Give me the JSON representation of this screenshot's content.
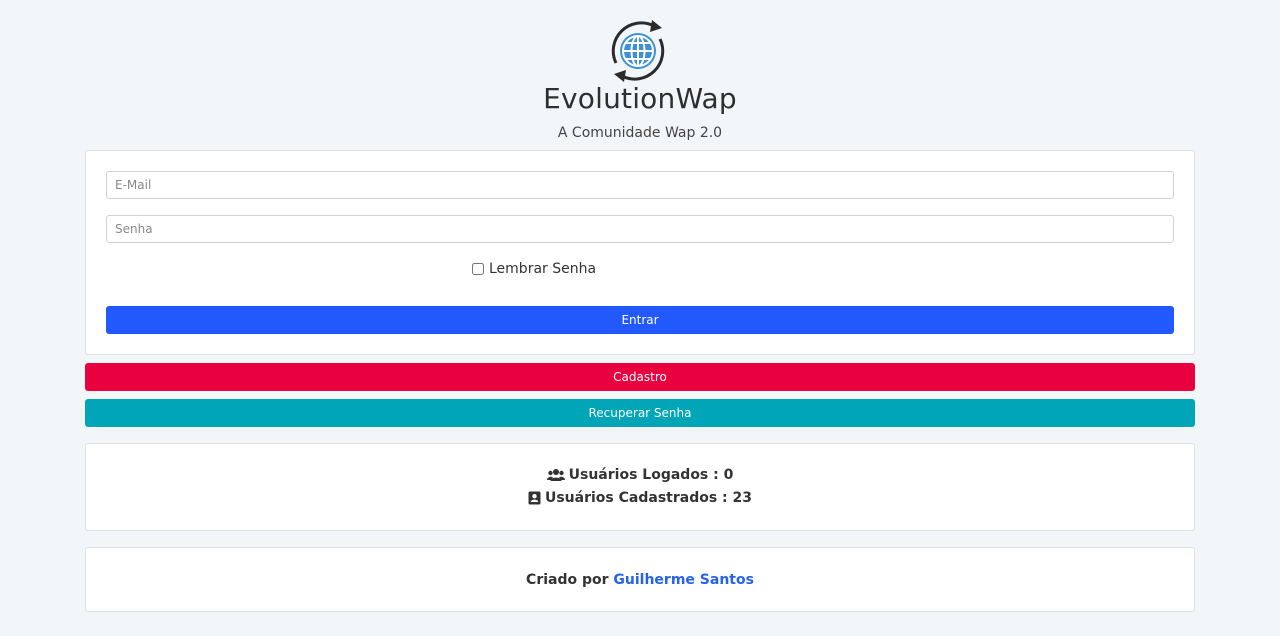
{
  "header": {
    "logo_icon": "globe-sync-icon",
    "brand": "EvolutionWap",
    "tagline": "A Comunidade Wap 2.0"
  },
  "login": {
    "email_placeholder": "E-Mail",
    "email_value": "",
    "password_placeholder": "Senha",
    "password_value": "",
    "remember_label": "Lembrar Senha",
    "remember_checked": false,
    "submit_label": "Entrar"
  },
  "actions": {
    "register_label": "Cadastro",
    "recover_label": "Recuperar Senha"
  },
  "stats": {
    "logged_icon": "users-icon",
    "logged_label": "Usuários Logados : 0",
    "registered_icon": "address-book-icon",
    "registered_label": "Usuários Cadastrados : 23"
  },
  "footer": {
    "created_by": "Criado por",
    "author": "Guilherme Santos"
  },
  "colors": {
    "primary": "#2159ff",
    "danger": "#e8003f",
    "info": "#00a5b8",
    "link": "#2563eb",
    "background": "#f3f6f9"
  }
}
